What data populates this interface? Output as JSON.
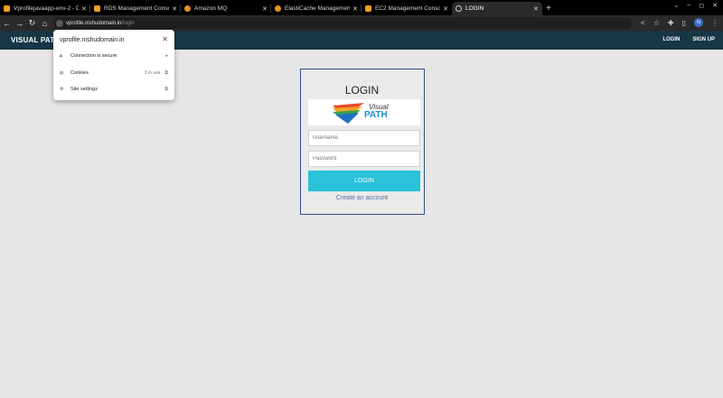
{
  "browser": {
    "tabs": [
      {
        "title": "Vprofilejavaapp-env-2 - D",
        "favicon": "elastic-beanstalk-icon",
        "active": false
      },
      {
        "title": "RDS Management Consol",
        "favicon": "rds-icon",
        "active": false
      },
      {
        "title": "Amazon MQ",
        "favicon": "aws-icon",
        "active": false
      },
      {
        "title": "ElastiCache Managemen",
        "favicon": "aws-icon",
        "active": false
      },
      {
        "title": "EC2 Management Conso",
        "favicon": "ec2-icon",
        "active": false
      },
      {
        "title": "LOGIN",
        "favicon": "globe-icon",
        "active": true
      }
    ],
    "new_tab_glyph": "+",
    "url_host": "vprofile.nishudomain.in",
    "url_path": "/login",
    "profile_initial": "N",
    "accent": "#3d6fc4"
  },
  "site_info": {
    "host": "vprofile.nishudomain.in",
    "rows": [
      {
        "label": "Connection is secure",
        "icon": "lock-icon"
      },
      {
        "label": "Cookies",
        "extra": "3 in use",
        "icon": "cookie-icon"
      },
      {
        "label": "Site settings",
        "icon": "gear-icon"
      }
    ]
  },
  "site": {
    "brand": "VISUAL PATH",
    "nav": {
      "login": "LOGIN",
      "signup": "SIGN UP"
    },
    "navbar_color": "#173646"
  },
  "login": {
    "title": "LOGIN",
    "logo": {
      "line1": "Visual",
      "line2": "PATH"
    },
    "username_placeholder": "Username",
    "password_placeholder": "Password",
    "button": "LOGIN",
    "create_account": "Create an account",
    "button_color": "#29c2d8",
    "border_color": "#2d4f8a"
  }
}
